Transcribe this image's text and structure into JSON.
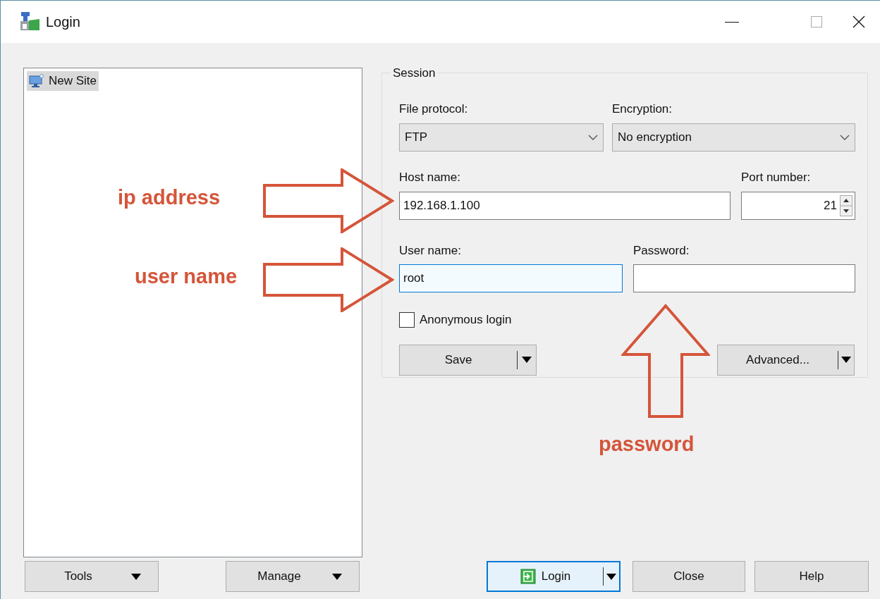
{
  "window": {
    "title": "Login"
  },
  "sites": [
    {
      "label": "New Site",
      "selected": true
    }
  ],
  "session": {
    "title": "Session",
    "file_protocol": {
      "label": "File protocol:",
      "value": "FTP"
    },
    "encryption": {
      "label": "Encryption:",
      "value": "No encryption"
    },
    "host_name": {
      "label": "Host name:",
      "value": "192.168.1.100"
    },
    "port_number": {
      "label": "Port number:",
      "value": "21"
    },
    "user_name": {
      "label": "User name:",
      "value": "root",
      "focused": true
    },
    "password": {
      "label": "Password:",
      "focused": false
    },
    "anonymous_login": {
      "label": "Anonymous login",
      "checked": false
    },
    "buttons": [
      {
        "label": "Save"
      },
      {
        "label": "Advanced..."
      }
    ]
  },
  "bottom_buttons": [
    {
      "label": "Tools",
      "kind": "menu",
      "default": false
    },
    {
      "label": "Manage",
      "kind": "menu",
      "default": false
    },
    {
      "label": "Login",
      "kind": "split",
      "default": true
    },
    {
      "label": "Close",
      "kind": "plain",
      "default": false
    },
    {
      "label": "Help",
      "kind": "plain",
      "default": false
    }
  ],
  "annotations": [
    {
      "text": "ip address",
      "kind": "right-arrow"
    },
    {
      "text": "user name",
      "kind": "right-arrow"
    },
    {
      "text": "password",
      "kind": "up-arrow"
    }
  ]
}
